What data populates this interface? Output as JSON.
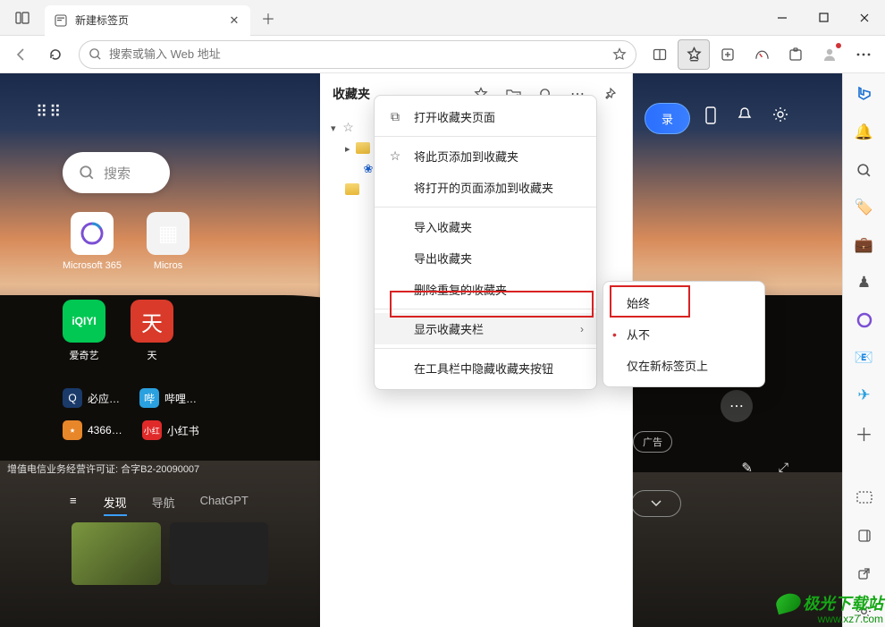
{
  "browser_tab": {
    "title": "新建标签页"
  },
  "addressbar": {
    "placeholder": "搜索或输入 Web 地址"
  },
  "favorites_panel": {
    "title": "收藏夹"
  },
  "context_menu": {
    "open_page": "打开收藏夹页面",
    "add_this": "将此页添加到收藏夹",
    "add_open": "将打开的页面添加到收藏夹",
    "import": "导入收藏夹",
    "export": "导出收藏夹",
    "dedupe": "删除重复的收藏夹",
    "show_bar": "显示收藏夹栏",
    "hide_btn": "在工具栏中隐藏收藏夹按钮"
  },
  "submenu": {
    "always": "始终",
    "never": "从不",
    "newtab_only": "仅在新标签页上"
  },
  "ntp": {
    "login": "录",
    "search_hint": "搜索",
    "tiles": {
      "m365": "Microsoft 365",
      "ms_short": "Micros",
      "iqiyi": "爱奇艺",
      "tianq": "天"
    },
    "quicklinks": {
      "biying": "必应…",
      "bili": "哔哩…",
      "num": "4366…",
      "xhs": "小红书"
    },
    "license": "增值电信业务经营许可证: 合字B2-20090007",
    "strip": {
      "discover": "发现",
      "nav": "导航",
      "chatgpt": "ChatGPT"
    },
    "ad": "广告"
  },
  "watermark": {
    "brand": "极光下载站",
    "url": "www.xz7.com"
  }
}
